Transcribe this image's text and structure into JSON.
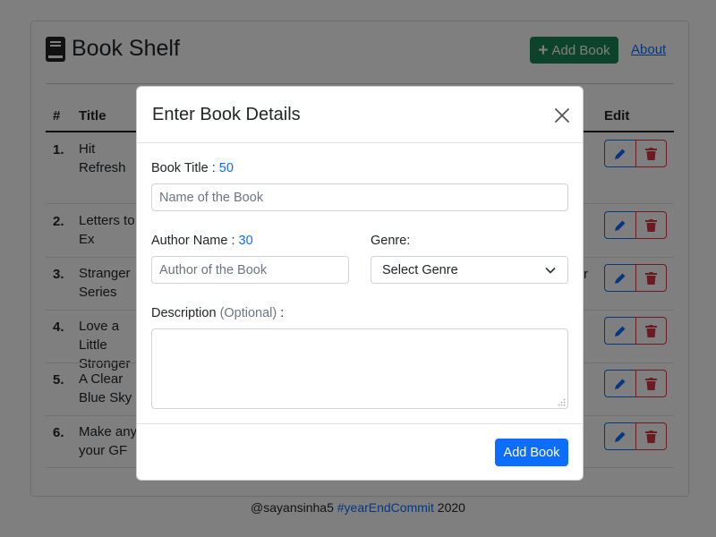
{
  "app": {
    "title": "Book Shelf",
    "add_button_label": "Add Book",
    "about_link": "About"
  },
  "table": {
    "headers": [
      "#",
      "Title",
      "Edit"
    ],
    "rows": [
      {
        "num": "1.",
        "title": "Hit Refresh"
      },
      {
        "num": "2.",
        "title": "Letters to Ex"
      },
      {
        "num": "3.",
        "title": "Stranger Series"
      },
      {
        "num": "4.",
        "title": "Love a Little Stronger"
      },
      {
        "num": "5.",
        "title": "A Clear Blue Sky"
      },
      {
        "num": "6.",
        "title": "Make any your GF"
      }
    ],
    "row3_peek_text": "r"
  },
  "modal": {
    "title": "Enter Book Details",
    "book_title_label": "Book Title :",
    "book_title_count": "50",
    "book_title_placeholder": "Name of the Book",
    "author_label": "Author Name :",
    "author_count": "30",
    "author_placeholder": "Author of the Book",
    "genre_label": "Genre:",
    "genre_selected": "Select Genre",
    "description_label": "Description",
    "description_optional": "(Optional)",
    "description_colon": ":",
    "submit_label": "Add Book"
  },
  "footer": {
    "handle": "@sayansinha5",
    "hashtag": "#yearEndCommit",
    "year": "2020"
  },
  "colors": {
    "primary": "#0d6efd",
    "success": "#198754",
    "danger": "#dc3545"
  },
  "icons": [
    "book-icon",
    "plus-icon",
    "pencil-icon",
    "trash-icon",
    "close-icon",
    "chevron-down-icon",
    "resize-grip-icon"
  ]
}
